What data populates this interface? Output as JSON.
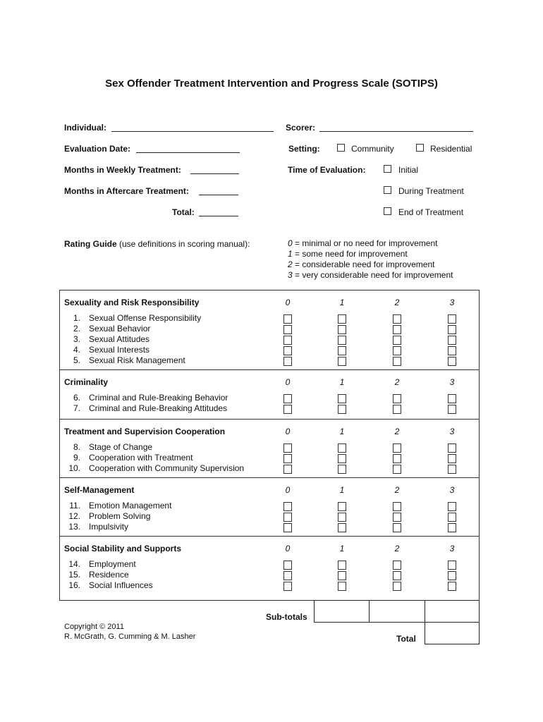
{
  "title": "Sex Offender Treatment Intervention and Progress Scale (SOTIPS)",
  "fields": {
    "individual_label": "Individual:",
    "individual_value": "",
    "evaluation_date_label": "Evaluation Date:",
    "evaluation_date_value": "",
    "weekly_label": "Months in Weekly Treatment:",
    "weekly_value": "",
    "aftercare_label": "Months in Aftercare Treatment:",
    "aftercare_value": "",
    "total_label": "Total:",
    "total_value": "",
    "scorer_label": "Scorer:",
    "scorer_value": ""
  },
  "setting": {
    "label": "Setting:",
    "options": [
      {
        "label": "Community",
        "checked": false
      },
      {
        "label": "Residential",
        "checked": false
      }
    ]
  },
  "time_of_evaluation": {
    "label": "Time of Evaluation:",
    "options": [
      {
        "label": "Initial",
        "checked": false
      },
      {
        "label": "During Treatment",
        "checked": false
      },
      {
        "label": "End of Treatment",
        "checked": false
      }
    ]
  },
  "rating_guide": {
    "label_bold": "Rating Guide",
    "label_rest": " (use definitions in scoring manual):",
    "levels": [
      {
        "score": "0",
        "text": " = minimal or no need for improvement"
      },
      {
        "score": "1",
        "text": " = some need for improvement"
      },
      {
        "score": "2",
        "text": " = considerable need for improvement"
      },
      {
        "score": "3",
        "text": " = very considerable need for improvement"
      }
    ]
  },
  "score_headers": [
    "0",
    "1",
    "2",
    "3"
  ],
  "sections": [
    {
      "title": "Sexuality and Risk Responsibility",
      "items": [
        {
          "num": "1.",
          "label": "Sexual Offense Responsibility"
        },
        {
          "num": "2.",
          "label": "Sexual Behavior"
        },
        {
          "num": "3.",
          "label": "Sexual Attitudes"
        },
        {
          "num": "4.",
          "label": "Sexual Interests"
        },
        {
          "num": "5.",
          "label": "Sexual Risk Management"
        }
      ]
    },
    {
      "title": "Criminality",
      "items": [
        {
          "num": "6.",
          "label": "Criminal and Rule-Breaking Behavior"
        },
        {
          "num": "7.",
          "label": "Criminal and Rule-Breaking Attitudes"
        }
      ]
    },
    {
      "title": "Treatment and Supervision Cooperation",
      "items": [
        {
          "num": "8.",
          "label": "Stage of Change"
        },
        {
          "num": "9.",
          "label": "Cooperation with Treatment"
        },
        {
          "num": "10.",
          "label": "Cooperation with Community Supervision"
        }
      ]
    },
    {
      "title": "Self-Management",
      "items": [
        {
          "num": "11.",
          "label": "Emotion Management"
        },
        {
          "num": "12.",
          "label": "Problem Solving"
        },
        {
          "num": "13.",
          "label": "Impulsivity"
        }
      ]
    },
    {
      "title": "Social Stability and Supports",
      "items": [
        {
          "num": "14.",
          "label": "Employment"
        },
        {
          "num": "15.",
          "label": "Residence"
        },
        {
          "num": "16.",
          "label": "Social Influences"
        }
      ]
    }
  ],
  "totals": {
    "subtotals_label": "Sub-totals",
    "subtotal_values": [
      "",
      "",
      ""
    ],
    "total_label": "Total",
    "total_value": ""
  },
  "copyright": {
    "line1": "Copyright © 2011",
    "line2": "R. McGrath, G. Cumming & M. Lasher"
  }
}
